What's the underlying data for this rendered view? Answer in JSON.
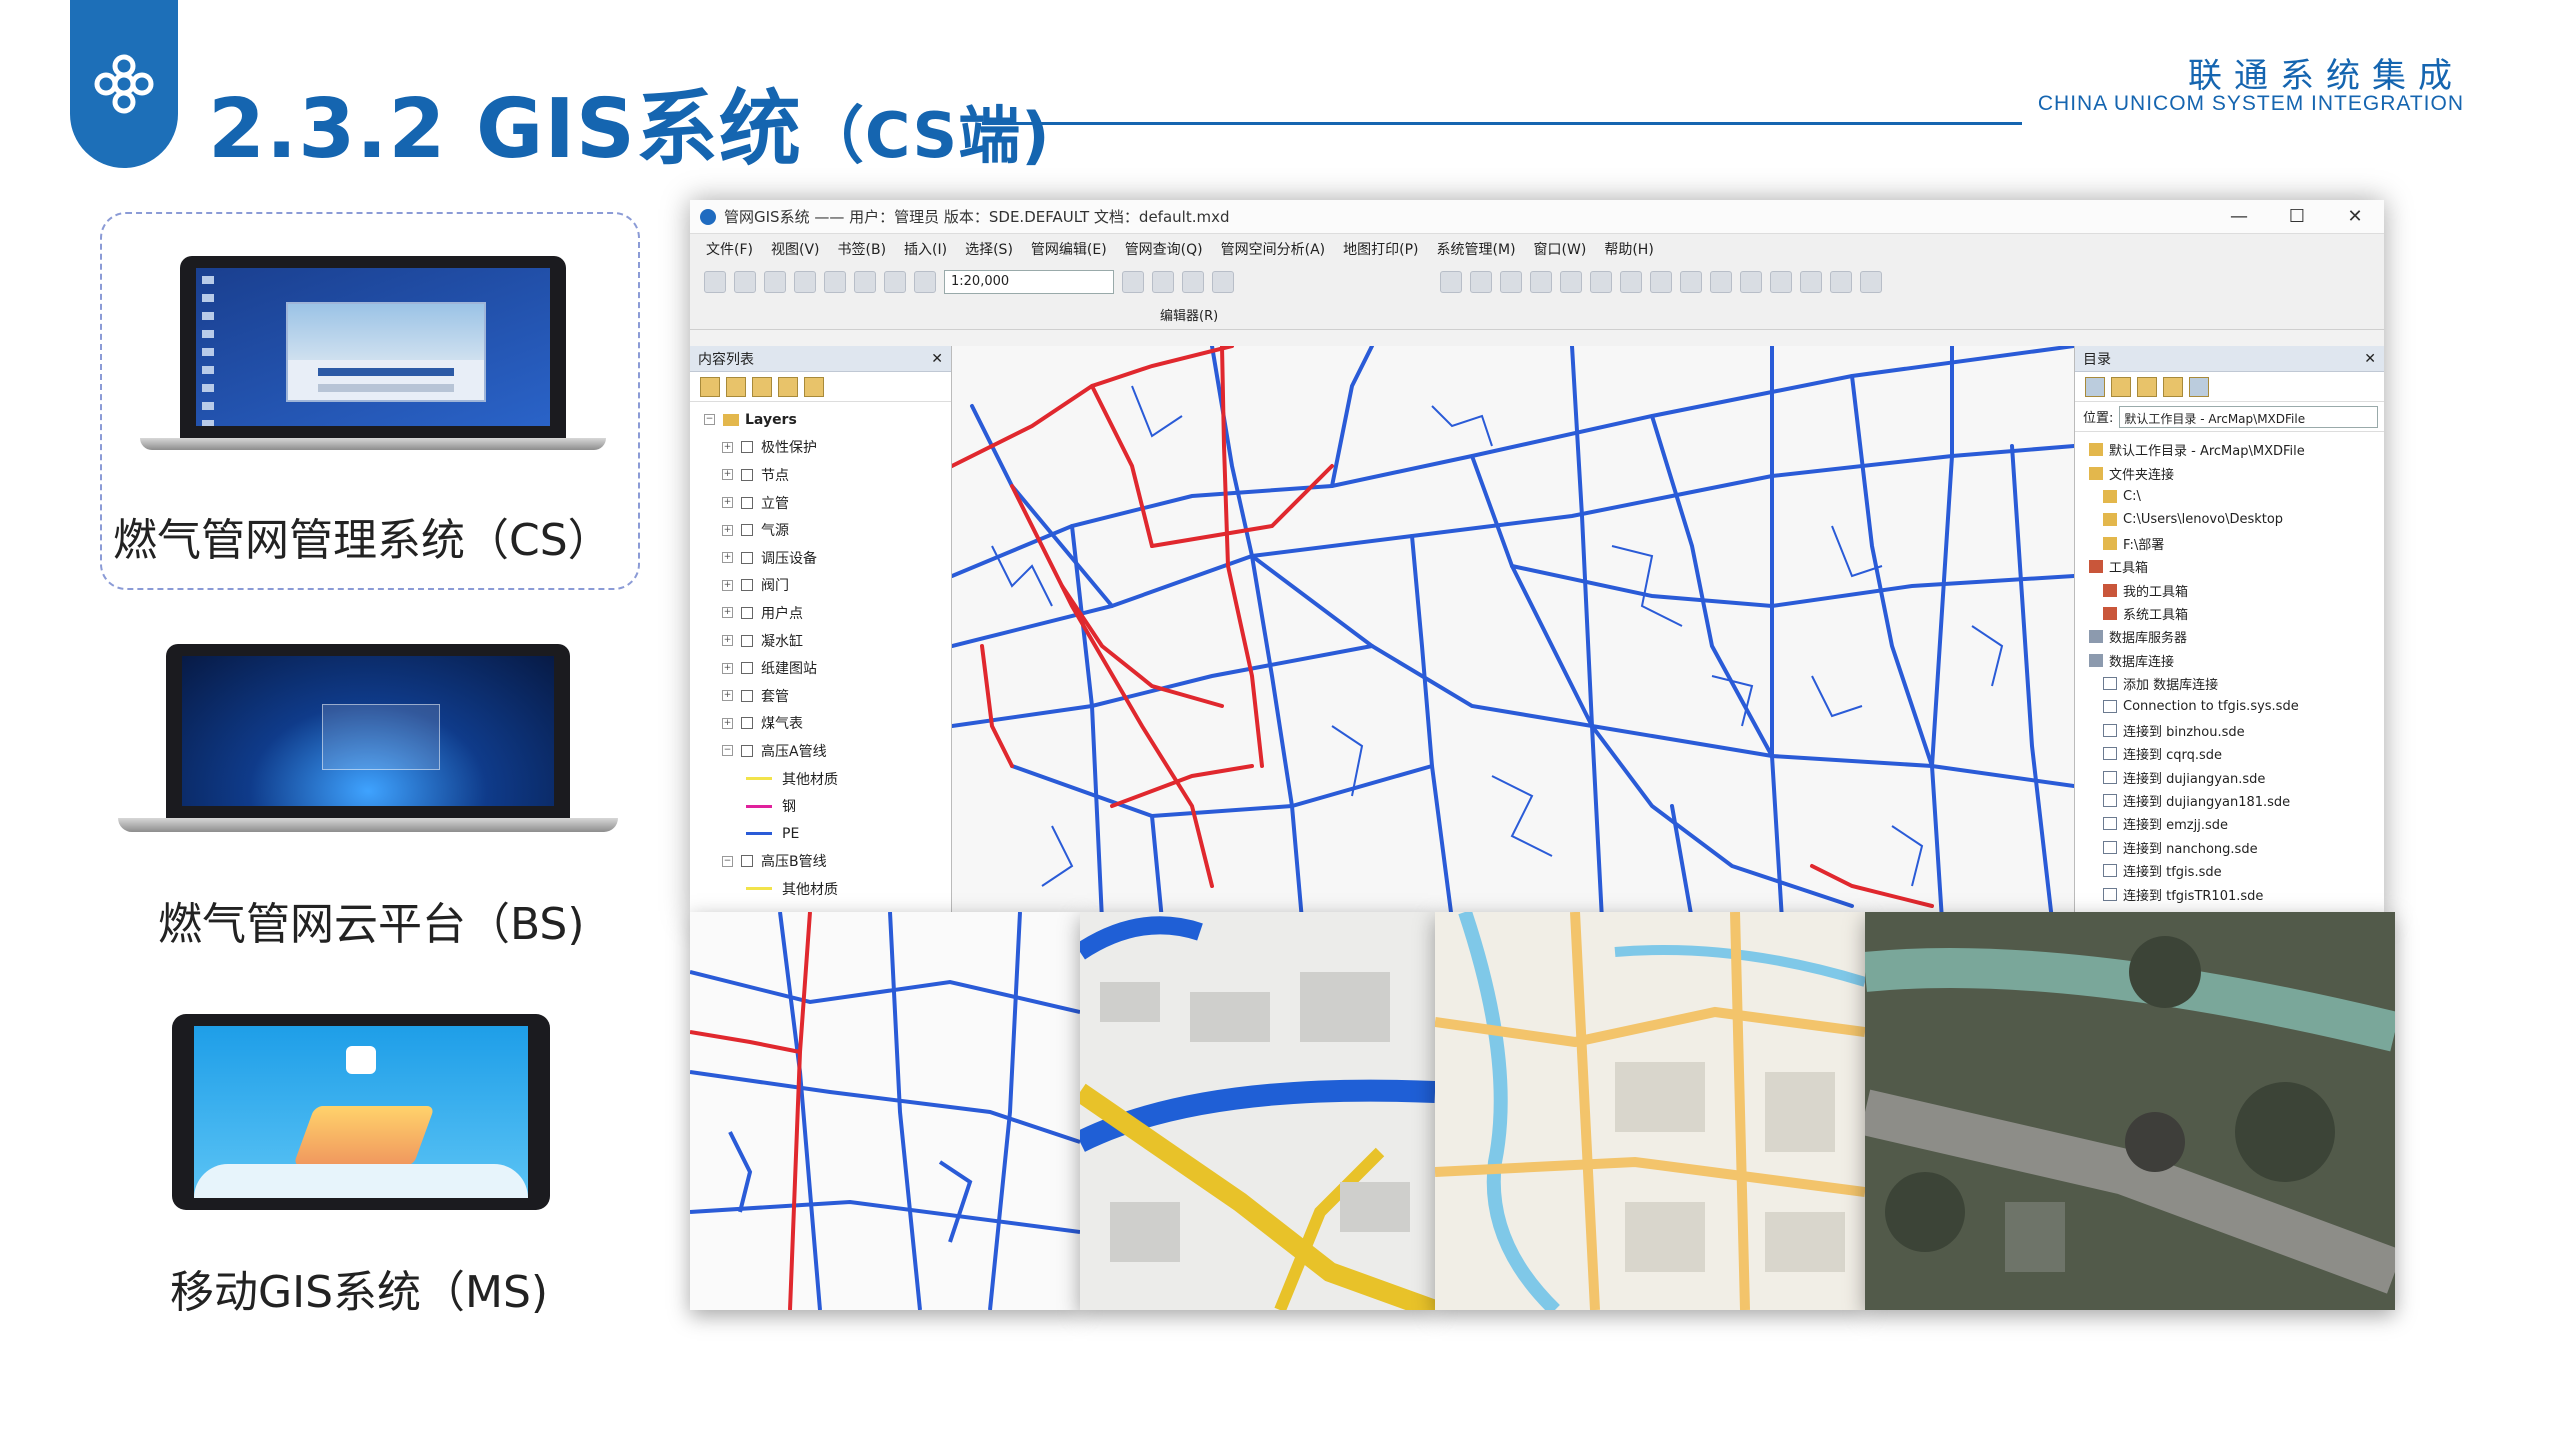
{
  "header": {
    "title": "2.3.2 GIS系统",
    "title_suffix": "（CS端)",
    "brand_cn": "联通系统集成",
    "brand_en": "CHINA UNICOM SYSTEM INTEGRATION"
  },
  "devices": [
    {
      "label": "燃气管网管理系统（CS）"
    },
    {
      "label": "燃气管网云平台（BS)"
    },
    {
      "label": "移动GIS系统（MS)"
    }
  ],
  "gis_window": {
    "title": "管网GIS系统 —— 用户：管理员   版本：SDE.DEFAULT   文档：default.mxd",
    "window_controls": [
      "—",
      "☐",
      "✕"
    ],
    "menus": [
      "文件(F)",
      "视图(V)",
      "书签(B)",
      "插入(I)",
      "选择(S)",
      "管网编辑(E)",
      "管网查询(Q)",
      "管网空间分析(A)",
      "地图打印(P)",
      "系统管理(M)",
      "窗口(W)",
      "帮助(H)"
    ],
    "scale": "1:20,000",
    "editor_label": "编辑器(R)",
    "toc": {
      "title": "内容列表",
      "root": "Layers",
      "layers": [
        "极性保护",
        "节点",
        "立管",
        "气源",
        "调压设备",
        "阀门",
        "用户点",
        "凝水缸",
        "纸建图站",
        "套管",
        "煤气表"
      ],
      "group_a": "高压A管线",
      "group_a_items": [
        {
          "label": "其他材质",
          "color": "#f2e34a"
        },
        {
          "label": "钢",
          "color": "#e0219c"
        },
        {
          "label": "PE",
          "color": "#2a5bd7"
        }
      ],
      "group_b": "高压B管线",
      "group_b_items": [
        {
          "label": "其他材质",
          "color": "#f2e34a"
        }
      ]
    },
    "catalog": {
      "title": "目录",
      "location_label": "位置:",
      "location_value": "默认工作目录 - ArcMap\\MXDFile",
      "items": [
        {
          "label": "默认工作目录 - ArcMap\\MXDFile",
          "indent": 1,
          "icon": "folder"
        },
        {
          "label": "文件夹连接",
          "indent": 1,
          "icon": "folder"
        },
        {
          "label": "C:\\",
          "indent": 2,
          "icon": "folder"
        },
        {
          "label": "C:\\Users\\lenovo\\Desktop",
          "indent": 2,
          "icon": "folder"
        },
        {
          "label": "F:\\部署",
          "indent": 2,
          "icon": "folder"
        },
        {
          "label": "工具箱",
          "indent": 1,
          "icon": "tool"
        },
        {
          "label": "我的工具箱",
          "indent": 2,
          "icon": "tool"
        },
        {
          "label": "系统工具箱",
          "indent": 2,
          "icon": "tool"
        },
        {
          "label": "数据库服务器",
          "indent": 1,
          "icon": "db"
        },
        {
          "label": "数据库连接",
          "indent": 1,
          "icon": "db"
        },
        {
          "label": "添加 数据库连接",
          "indent": 2,
          "icon": "conn"
        },
        {
          "label": "Connection to tfgis.sys.sde",
          "indent": 2,
          "icon": "conn"
        },
        {
          "label": "连接到 binzhou.sde",
          "indent": 2,
          "icon": "conn"
        },
        {
          "label": "连接到 cqrq.sde",
          "indent": 2,
          "icon": "conn"
        },
        {
          "label": "连接到 dujiangyan.sde",
          "indent": 2,
          "icon": "conn"
        },
        {
          "label": "连接到 dujiangyan181.sde",
          "indent": 2,
          "icon": "conn"
        },
        {
          "label": "连接到 emzjj.sde",
          "indent": 2,
          "icon": "conn"
        },
        {
          "label": "连接到 nanchong.sde",
          "indent": 2,
          "icon": "conn"
        },
        {
          "label": "连接到 tfgis.sde",
          "indent": 2,
          "icon": "conn"
        },
        {
          "label": "连接到 tfgisTR101.sde",
          "indent": 2,
          "icon": "conn"
        }
      ]
    }
  },
  "colors": {
    "brand_blue": "#1565b0",
    "pipe_blue": "#2a5bd7",
    "pipe_red": "#e0282e"
  }
}
